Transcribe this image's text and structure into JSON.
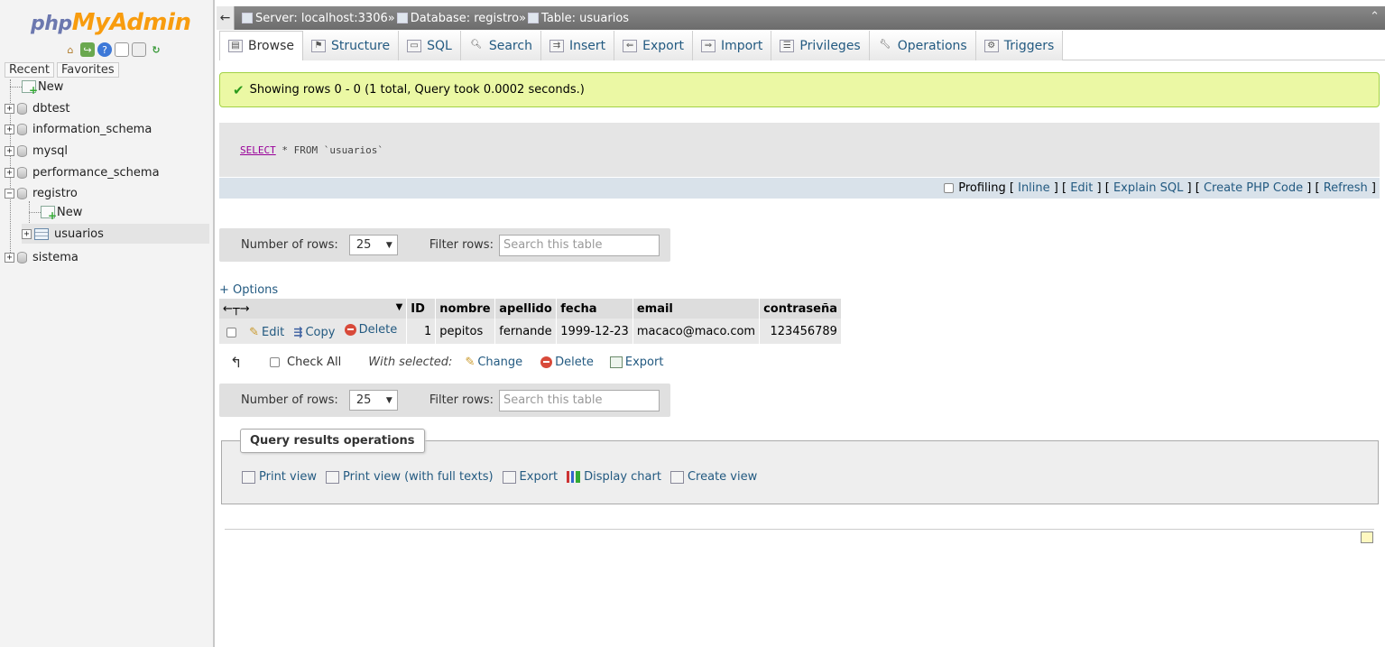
{
  "nav": {
    "logo": {
      "php": "php",
      "my": "My",
      "admin": "Admin"
    },
    "icons": [
      "home-icon",
      "logout-icon",
      "help-icon",
      "docs-icon",
      "settings-icon",
      "reload-icon"
    ],
    "tabs": {
      "recent": "Recent",
      "favorites": "Favorites"
    },
    "tree": {
      "new": "New",
      "databases": [
        "dbtest",
        "information_schema",
        "mysql",
        "performance_schema",
        "registro",
        "sistema"
      ],
      "registro_children": {
        "new": "New",
        "table": "usuarios"
      }
    }
  },
  "breadcrumb": {
    "server": "Server: localhost:3306",
    "database": "Database: registro",
    "table": "Table: usuarios",
    "separator": "»"
  },
  "tabs": [
    "Browse",
    "Structure",
    "SQL",
    "Search",
    "Insert",
    "Export",
    "Import",
    "Privileges",
    "Operations",
    "Triggers"
  ],
  "message": "Showing rows 0 - 0 (1 total, Query took 0.0002 seconds.)",
  "sql": {
    "select": "SELECT",
    "rest": " * FROM `usuarios`"
  },
  "sql_links": {
    "profiling": "Profiling",
    "inline": "Inline",
    "edit": "Edit",
    "explain": "Explain SQL",
    "php": "Create PHP Code",
    "refresh": "Refresh"
  },
  "row_nav": {
    "rows_label": "Number of rows:",
    "rows_value": "25",
    "filter_label": "Filter rows:",
    "filter_placeholder": "Search this table"
  },
  "options": "+ Options",
  "table": {
    "columns": [
      "ID",
      "nombre",
      "apellido",
      "fecha",
      "email",
      "contraseña"
    ],
    "row": {
      "edit": "Edit",
      "copy": "Copy",
      "delete": "Delete",
      "id": "1",
      "nombre": "pepitos",
      "apellido": "fernande",
      "fecha": "1999-12-23",
      "email": "macaco@maco.com",
      "password": "123456789"
    }
  },
  "with_selected": {
    "check_all": "Check All",
    "label": "With selected:",
    "change": "Change",
    "delete": "Delete",
    "export": "Export"
  },
  "qro": {
    "legend": "Query results operations",
    "print": "Print view",
    "print_full": "Print view (with full texts)",
    "export": "Export",
    "chart": "Display chart",
    "view": "Create view"
  },
  "colors": {
    "link": "#235a81",
    "success_bg": "#ebf8a4",
    "logo_orange": "#f89c0e",
    "logo_blue": "#6c78af"
  }
}
